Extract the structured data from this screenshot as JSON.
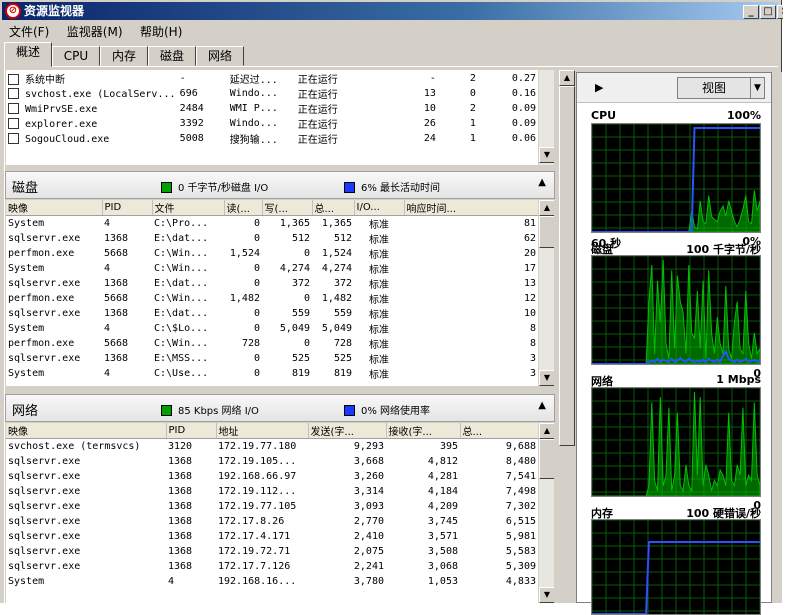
{
  "window": {
    "title": "资源监视器"
  },
  "menu": [
    "文件(F)",
    "监视器(M)",
    "帮助(H)"
  ],
  "tabs": [
    "概述",
    "CPU",
    "内存",
    "磁盘",
    "网络"
  ],
  "cpu_rows": [
    [
      "系统中断",
      "-",
      "延迟过...",
      "正在运行",
      "-",
      "2",
      "0.27"
    ],
    [
      "svchost.exe (LocalServ...",
      "696",
      "Windo...",
      "正在运行",
      "13",
      "0",
      "0.16"
    ],
    [
      "WmiPrvSE.exe",
      "2484",
      "WMI P...",
      "正在运行",
      "10",
      "2",
      "0.09"
    ],
    [
      "explorer.exe",
      "3392",
      "Windo...",
      "正在运行",
      "26",
      "1",
      "0.09"
    ],
    [
      "SogouCloud.exe",
      "5008",
      "搜狗输...",
      "正在运行",
      "24",
      "1",
      "0.06"
    ]
  ],
  "disk": {
    "title": "磁盘",
    "legend1": "0 千字节/秒磁盘 I/O",
    "legend2": "6% 最长活动时间",
    "headers": [
      "映像",
      "PID",
      "文件",
      "读(...",
      "写(...",
      "总...",
      "I/O...",
      "响应时间..."
    ],
    "rows": [
      [
        "System",
        "4",
        "C:\\Pro...",
        "0",
        "1,365",
        "1,365",
        "标准",
        "81"
      ],
      [
        "sqlservr.exe",
        "1368",
        "E:\\dat...",
        "0",
        "512",
        "512",
        "标准",
        "62"
      ],
      [
        "perfmon.exe",
        "5668",
        "C:\\Win...",
        "1,524",
        "0",
        "1,524",
        "标准",
        "20"
      ],
      [
        "System",
        "4",
        "C:\\Win...",
        "0",
        "4,274",
        "4,274",
        "标准",
        "17"
      ],
      [
        "sqlservr.exe",
        "1368",
        "E:\\dat...",
        "0",
        "372",
        "372",
        "标准",
        "13"
      ],
      [
        "perfmon.exe",
        "5668",
        "C:\\Win...",
        "1,482",
        "0",
        "1,482",
        "标准",
        "12"
      ],
      [
        "sqlservr.exe",
        "1368",
        "E:\\dat...",
        "0",
        "559",
        "559",
        "标准",
        "10"
      ],
      [
        "System",
        "4",
        "C:\\$Lo...",
        "0",
        "5,049",
        "5,049",
        "标准",
        "8"
      ],
      [
        "perfmon.exe",
        "5668",
        "C:\\Win...",
        "728",
        "0",
        "728",
        "标准",
        "8"
      ],
      [
        "sqlservr.exe",
        "1368",
        "E:\\MSS...",
        "0",
        "525",
        "525",
        "标准",
        "3"
      ],
      [
        "System",
        "4",
        "C:\\Use...",
        "0",
        "819",
        "819",
        "标准",
        "3"
      ]
    ]
  },
  "net": {
    "title": "网络",
    "legend1": "85 Kbps 网络 I/O",
    "legend2": "0% 网络使用率",
    "headers": [
      "映像",
      "PID",
      "地址",
      "发送(字...",
      "接收(字...",
      "总..."
    ],
    "rows": [
      [
        "svchost.exe (termsvcs)",
        "3120",
        "172.19.77.180",
        "9,293",
        "395",
        "9,688"
      ],
      [
        "sqlservr.exe",
        "1368",
        "172.19.105...",
        "3,668",
        "4,812",
        "8,480"
      ],
      [
        "sqlservr.exe",
        "1368",
        "192.168.66.97",
        "3,260",
        "4,281",
        "7,541"
      ],
      [
        "sqlservr.exe",
        "1368",
        "172.19.112...",
        "3,314",
        "4,184",
        "7,498"
      ],
      [
        "sqlservr.exe",
        "1368",
        "172.19.77.105",
        "3,093",
        "4,209",
        "7,302"
      ],
      [
        "sqlservr.exe",
        "1368",
        "172.17.8.26",
        "2,770",
        "3,745",
        "6,515"
      ],
      [
        "sqlservr.exe",
        "1368",
        "172.17.4.171",
        "2,410",
        "3,571",
        "5,981"
      ],
      [
        "sqlservr.exe",
        "1368",
        "172.19.72.71",
        "2,075",
        "3,508",
        "5,583"
      ],
      [
        "sqlservr.exe",
        "1368",
        "172.17.7.126",
        "2,241",
        "3,068",
        "5,309"
      ],
      [
        "System",
        "4",
        "192.168.16...",
        "3,780",
        "1,053",
        "4,833"
      ]
    ]
  },
  "right": {
    "view_label": "视图",
    "graphs": [
      {
        "label": "CPU",
        "right": "100%",
        "bottom_left": "60 秒",
        "bottom_right": "0%"
      },
      {
        "label": "磁盘",
        "right": "100 千字节/秒",
        "bottom_left": "",
        "bottom_right": "0"
      },
      {
        "label": "网络",
        "right": "1 Mbps",
        "bottom_left": "",
        "bottom_right": "0"
      },
      {
        "label": "内存",
        "right": "100 硬错误/秒",
        "bottom_left": "",
        "bottom_right": ""
      }
    ]
  },
  "colors": {
    "green": "#00c000",
    "blue": "#2a52ff",
    "grid": "#0a5a0a"
  }
}
